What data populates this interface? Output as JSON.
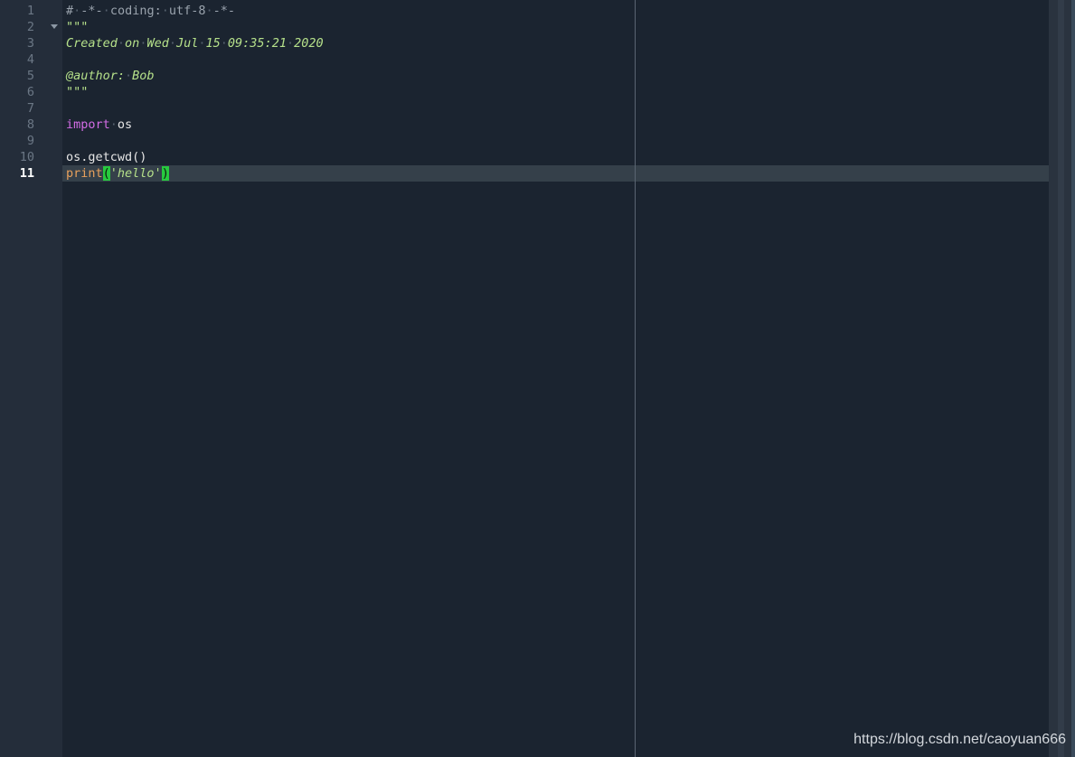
{
  "editor": {
    "current_line": 11,
    "line_numbers": [
      "1",
      "2",
      "3",
      "4",
      "5",
      "6",
      "7",
      "8",
      "9",
      "10",
      "11"
    ],
    "lines": {
      "l1": {
        "hash": "#",
        "dash1": "-*-",
        "coding": "coding:",
        "enc": "utf-8",
        "dash2": "-*-"
      },
      "l2": {
        "quotes": "\"\"\""
      },
      "l3": {
        "w1": "Created",
        "w2": "on",
        "w3": "Wed",
        "w4": "Jul",
        "w5": "15",
        "w6": "09:35:21",
        "w7": "2020"
      },
      "l5": {
        "w1": "@author:",
        "w2": "Bob"
      },
      "l6": {
        "quotes": "\"\"\""
      },
      "l8": {
        "kw": "import",
        "mod": "os"
      },
      "l10": {
        "code": "os.getcwd()"
      },
      "l11": {
        "fn": "print",
        "open": "(",
        "str": "'hello'",
        "close": ")"
      }
    },
    "whitespace_glyph": "·"
  },
  "colors": {
    "background": "#1b2430",
    "gutter": "#242d3a",
    "current_line": "#35404a",
    "keyword": "#d36de6",
    "builtin": "#e8a05c",
    "docstring": "#b5e08a",
    "comment": "#9aa3ad",
    "paren_match": "#27c93f"
  },
  "watermark": "https://blog.csdn.net/caoyuan666"
}
